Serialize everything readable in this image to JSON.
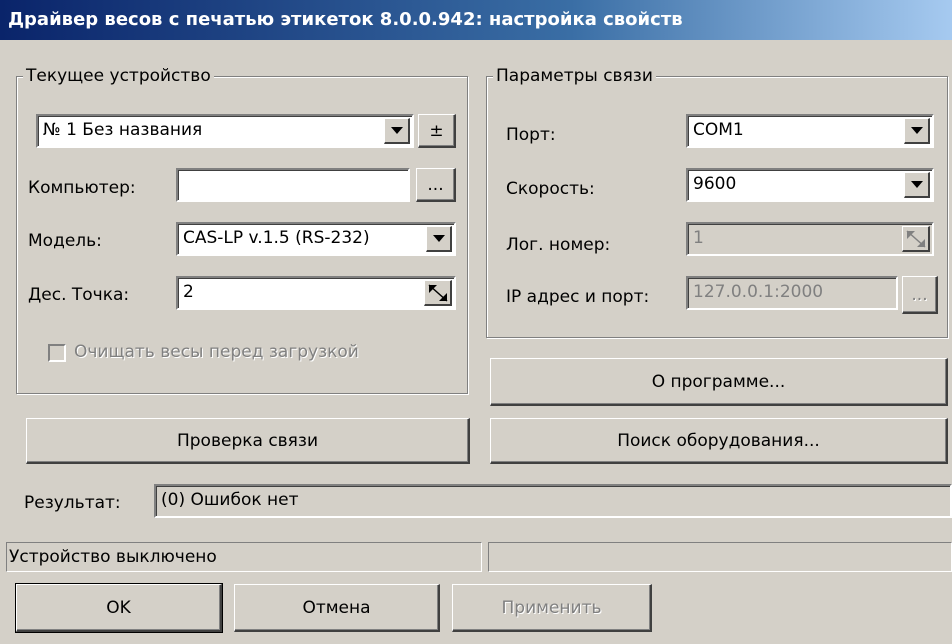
{
  "window": {
    "title": "Драйвер весов с печатью этикеток 8.0.0.942: настройка свойств"
  },
  "device_group": {
    "legend": "Текущее устройство",
    "device_select": "№ 1 Без названия",
    "plusminus_label": "±",
    "computer_label": "Компьютер:",
    "computer_value": "",
    "browse_label": "...",
    "model_label": "Модель:",
    "model_value": "CAS-LP v.1.5 (RS-232)",
    "decimal_label": "Дес. Точка:",
    "decimal_value": "2",
    "clear_label": "Очищать весы перед загрузкой"
  },
  "connection_group": {
    "legend": "Параметры связи",
    "port_label": "Порт:",
    "port_value": "COM1",
    "speed_label": "Скорость:",
    "speed_value": "9600",
    "lognum_label": "Лог. номер:",
    "lognum_value": "1",
    "ip_label": "IP адрес и порт:",
    "ip_value": "127.0.0.1:2000",
    "ip_browse_label": "..."
  },
  "buttons": {
    "about": "О программе...",
    "check": "Проверка связи",
    "search": "Поиск оборудования...",
    "ok": "OK",
    "cancel": "Отмена",
    "apply": "Применить"
  },
  "result": {
    "label": "Результат:",
    "value": "(0) Ошибок нет"
  },
  "status": {
    "left": "Устройство выключено",
    "right": ""
  }
}
